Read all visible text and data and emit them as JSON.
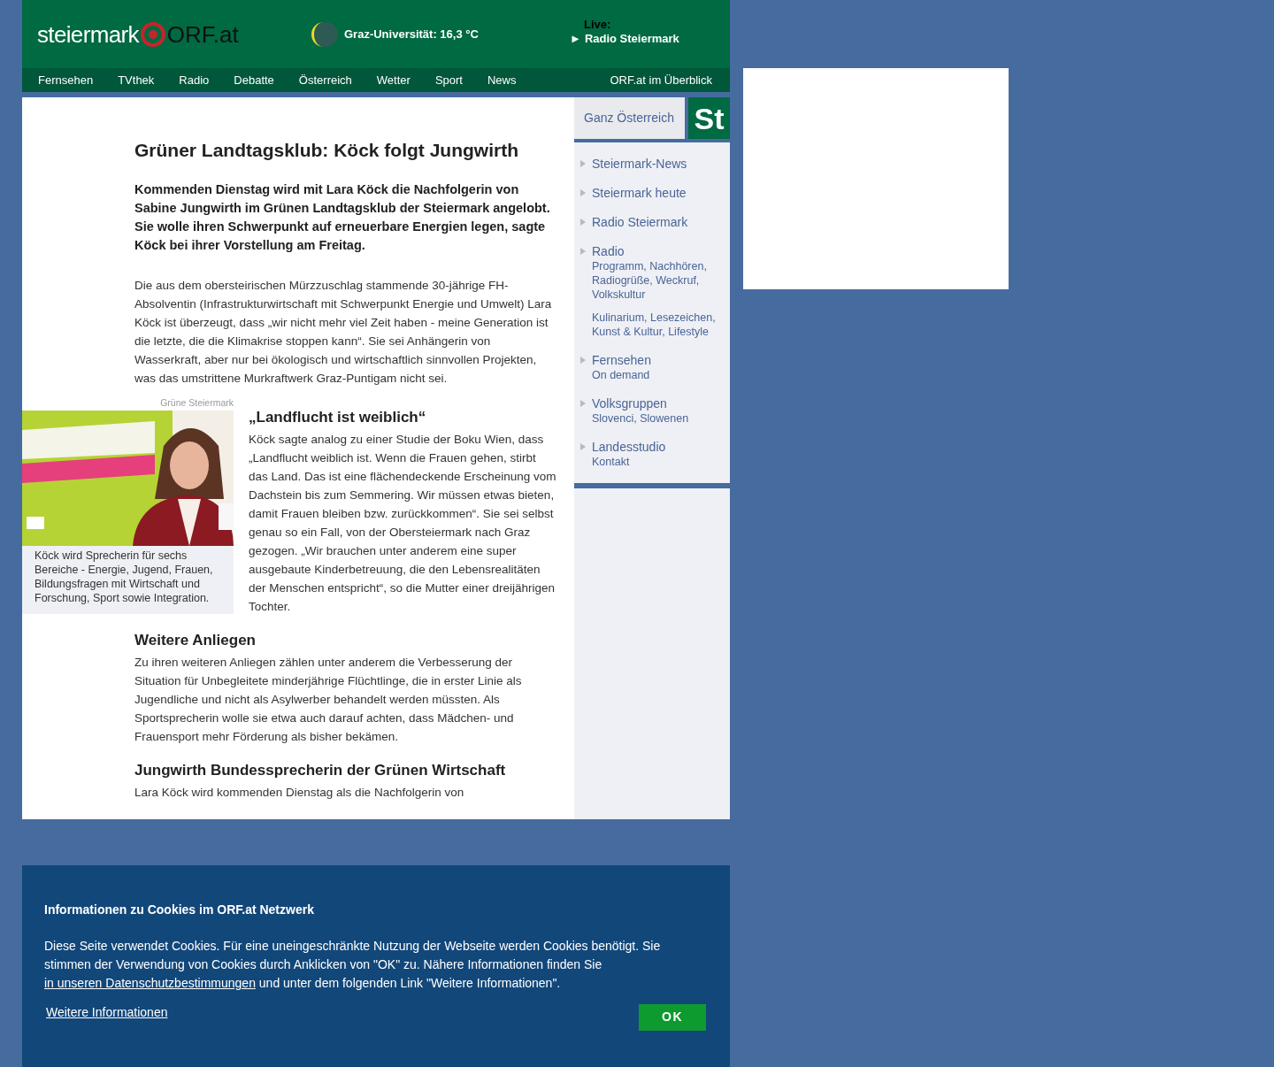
{
  "header": {
    "logo": {
      "region": "steiermark",
      "brand": "ORF.at"
    },
    "weather": "Graz-Universität: 16,3 °C",
    "live": {
      "label": "Live:",
      "play": "►",
      "station": "Radio Steiermark"
    }
  },
  "nav": {
    "items": [
      "Fernsehen",
      "TVthek",
      "Radio",
      "Debatte",
      "Österreich",
      "Wetter",
      "Sport",
      "News"
    ],
    "overview": "ORF.at im Überblick"
  },
  "article": {
    "title": "Grüner Landtagsklub: Köck folgt Jungwirth",
    "lead": "Kommenden Dienstag wird mit Lara Köck die Nachfolgerin von Sabine Jungwirth im Grünen Landtagsklub der Steiermark angelobt. Sie wolle ihren Schwerpunkt auf erneuerbare Energien legen, sagte Köck bei ihrer Vorstellung am Freitag.",
    "intro": "Die aus dem obersteirischen Mürzzuschlag stammende 30-jährige FH-Absolventin (Infrastrukturwirtschaft mit Schwerpunkt Energie und Umwelt) Lara Köck ist überzeugt, dass „wir nicht mehr viel Zeit haben - meine Generation ist die letzte, die die Klimakrise stoppen kann“. Sie sei Anhängerin von Wasserkraft, aber nur bei ökologisch und wirtschaftlich sinnvollen Projekten, was das umstrittene Murkraftwerk Graz-Puntigam nicht sei.",
    "image": {
      "credit": "Grüne Steiermark",
      "caption": "Köck wird Sprecherin für sechs Bereiche - Energie, Jugend, Frauen, Bildungsfragen mit Wirtschaft und Forschung, Sport sowie Integration."
    },
    "sections": [
      {
        "heading": "„Landflucht ist weiblich“",
        "text": "Köck sagte analog zu einer Studie der Boku Wien, dass „Landflucht weiblich ist. Wenn die Frauen gehen, stirbt das Land. Das ist eine flächendeckende Erscheinung vom Dachstein bis zum Semmering. Wir müssen etwas bieten, damit Frauen bleiben bzw. zurückkommen“. Sie sei selbst genau so ein Fall, von der Obersteiermark nach Graz gezogen. „Wir brauchen unter anderem eine super ausgebaute Kinderbetreuung, die den Lebensrealitäten der Menschen entspricht“, so die Mutter einer dreijährigen Tochter."
      },
      {
        "heading": "Weitere Anliegen",
        "text": "Zu ihren weiteren Anliegen zählen unter anderem die Verbesserung der Situation für Unbegleitete minderjährige Flüchtlinge, die in erster Linie als Jugendliche und nicht als Asylwerber behandelt werden müssten. Als Sportsprecherin wolle sie etwa auch darauf achten, dass Mädchen- und Frauensport mehr Förderung als bisher bekämen."
      },
      {
        "heading": "Jungwirth Bundessprecherin der Grünen Wirtschaft",
        "text": "Lara Köck wird kommenden Dienstag als die Nachfolgerin von"
      }
    ]
  },
  "sidebar": {
    "switch": "Ganz Österreich",
    "region_badge": "St",
    "items": [
      {
        "title": "Steiermark-News"
      },
      {
        "title": "Steiermark heute"
      },
      {
        "title": "Radio Steiermark"
      },
      {
        "title": "Radio",
        "details": [
          "Programm, Nachhören, Radiogrüße, Weckruf, Volkskultur",
          "Kulinarium, Lesezeichen, Kunst & Kultur, Lifestyle"
        ]
      },
      {
        "title": "Fernsehen",
        "details": [
          "On demand"
        ]
      },
      {
        "title": "Volksgruppen",
        "details": [
          "Slovenci, Slowenen"
        ]
      },
      {
        "title": "Landesstudio",
        "details": [
          "Kontakt"
        ]
      }
    ]
  },
  "cookie_banner": {
    "title": "Informationen zu Cookies im ORF.at Netzwerk",
    "text_before": "Diese Seite verwendet Cookies. Für eine uneingeschränkte Nutzung der Webseite werden Cookies benötigt. Sie stimmen der Verwendung von Cookies durch Anklicken von \"OK\" zu. Nähere Informationen finden Sie ",
    "link": "in unseren Datenschutzbestimmungen",
    "text_after": " und unter dem folgenden Link \"Weitere Informationen\".",
    "more": "Weitere Informationen",
    "ok": "OK"
  }
}
